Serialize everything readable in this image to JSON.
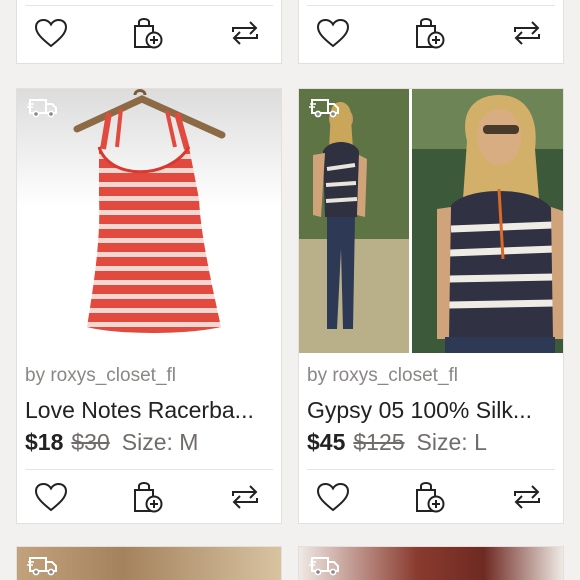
{
  "icons": {
    "like": "heart-icon",
    "bundle": "shopping-bag-plus-icon",
    "share": "share-arrows-icon",
    "shipping": "delivery-truck-icon"
  },
  "listings": [
    {
      "seller": "by roxys_closet_fl",
      "title": "Love Notes Racerba...",
      "price": "$18",
      "original_price": "$30",
      "size": "Size: M"
    },
    {
      "seller": "by roxys_closet_fl",
      "title": "Gypsy 05 100% Silk...",
      "price": "$45",
      "original_price": "$125",
      "size": "Size: L"
    }
  ]
}
